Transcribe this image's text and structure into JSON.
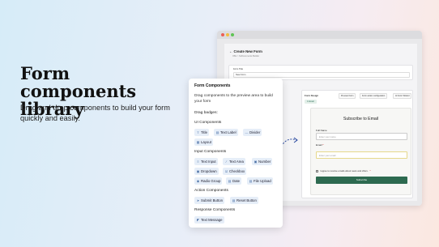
{
  "hero": {
    "title": "Form components library",
    "subtitle": "Drag and drop components to build your form quickly and easily."
  },
  "app": {
    "header": {
      "back_icon": "arrow-left-icon",
      "title": "Create New Form",
      "subtitle": "OBs > SoDocuments Builder"
    },
    "form_title": {
      "label": "Form Title",
      "value": "New Form"
    },
    "design": {
      "label": "Form Design",
      "tabs": [
        "Preview Form",
        "Form action configuration",
        "AI Form Wizard"
      ],
      "chip": "1 Email"
    },
    "preview": {
      "title": "Subscribe to Email",
      "name_label": "Full Name",
      "name_placeholder": "Enter your name",
      "email_label": "Email",
      "required_mark": "*",
      "email_placeholder": "Enter your email",
      "consent": "I agree to receive emails about news and offers.",
      "consent_required": "*",
      "submit": "Subscribe"
    }
  },
  "panel": {
    "title": "Form Components",
    "description": "Drag components to the preview area to build your form",
    "badges_label": "Drag badges:",
    "sections": [
      {
        "title": "UI Components",
        "items": [
          {
            "label": "Title",
            "icon": "title-icon"
          },
          {
            "label": "Text Label",
            "icon": "text-label-icon"
          },
          {
            "label": "Divider",
            "icon": "divider-icon"
          },
          {
            "label": "Layout",
            "icon": "layout-icon"
          }
        ]
      },
      {
        "title": "Input Components",
        "items": [
          {
            "label": "Text Input",
            "icon": "text-input-icon"
          },
          {
            "label": "Text Area",
            "icon": "text-area-icon"
          },
          {
            "label": "Number",
            "icon": "number-icon"
          },
          {
            "label": "Dropdown",
            "icon": "dropdown-icon"
          },
          {
            "label": "Checkbox",
            "icon": "checkbox-icon"
          },
          {
            "label": "Radio Group",
            "icon": "radio-icon"
          },
          {
            "label": "Date",
            "icon": "date-icon"
          },
          {
            "label": "File Upload",
            "icon": "upload-icon"
          }
        ]
      },
      {
        "title": "Action Components",
        "items": [
          {
            "label": "Submit Button",
            "icon": "submit-icon"
          },
          {
            "label": "Reset Button",
            "icon": "reset-icon"
          }
        ]
      },
      {
        "title": "Response Components",
        "items": [
          {
            "label": "Text Message",
            "icon": "message-icon"
          }
        ]
      }
    ]
  },
  "colors": {
    "accent_green": "#2d6a50",
    "chip_bg": "#e6eef8",
    "arrow": "#2a4aa0"
  }
}
